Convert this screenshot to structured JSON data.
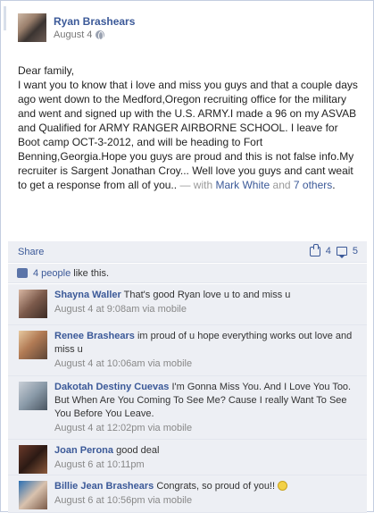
{
  "post": {
    "author": "Ryan Brashears",
    "date": "August 4",
    "greeting": "Dear family,",
    "message": "I want you to know that i love and miss you guys and that a couple days ago went down to the Medford,Oregon recruiting office for the military and went and signed up with the U.S. ARMY.I made a 96 on my ASVAB and Qualified for ARMY RANGER AIRBORNE SCHOOL. I leave for Boot camp OCT-3-2012, and will be heading to Fort Benning,Georgia.Hope you guys are proud and this is not false info.My recruiter is Sargent Jonathan Croy... Well love you guys and cant weait to get a response from all of you..",
    "with_prefix": "— with",
    "tagged_name": "Mark White",
    "and_word": "and",
    "others_link": "7 others",
    "end_punct": "."
  },
  "actions": {
    "share_label": "Share",
    "like_count": "4",
    "comment_count": "5"
  },
  "likes": {
    "people_link": "4 people",
    "suffix": "like this."
  },
  "comments": [
    {
      "name": "Shayna Waller",
      "text": "That's good Ryan love u to and miss u",
      "meta": "August 4 at 9:08am via mobile"
    },
    {
      "name": "Renee Brashears",
      "text": "im proud of u hope everything works out love and miss u",
      "meta": "August 4 at 10:06am via mobile"
    },
    {
      "name": "Dakotah Destiny Cuevas",
      "text": "I'm Gonna Miss You. And I Love You Too. But When Are You Coming To See Me? Cause I really Want To See You Before You Leave.",
      "meta": "August 4 at 12:02pm via mobile"
    },
    {
      "name": "Joan Perona",
      "text": "good deal",
      "meta": "August 6 at 10:11pm"
    },
    {
      "name": "Billie Jean Brashears",
      "text": "Congrats, so proud of you!!",
      "meta": "August 6 at 10:56pm via mobile"
    }
  ]
}
